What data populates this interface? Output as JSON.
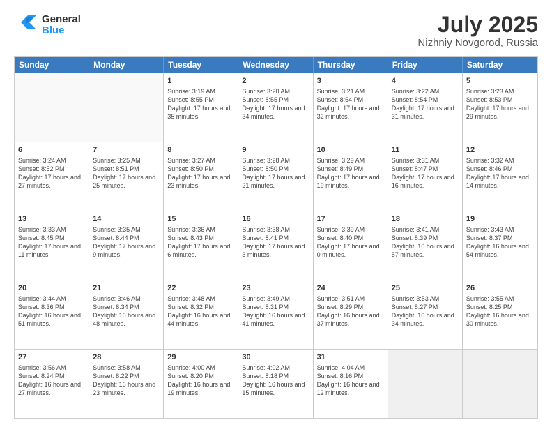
{
  "logo": {
    "general": "General",
    "blue": "Blue"
  },
  "title": {
    "month": "July 2025",
    "location": "Nizhniy Novgorod, Russia"
  },
  "header_days": [
    "Sunday",
    "Monday",
    "Tuesday",
    "Wednesday",
    "Thursday",
    "Friday",
    "Saturday"
  ],
  "rows": [
    [
      {
        "day": "",
        "text": "",
        "empty": true
      },
      {
        "day": "",
        "text": "",
        "empty": true
      },
      {
        "day": "1",
        "text": "Sunrise: 3:19 AM\nSunset: 8:55 PM\nDaylight: 17 hours and 35 minutes."
      },
      {
        "day": "2",
        "text": "Sunrise: 3:20 AM\nSunset: 8:55 PM\nDaylight: 17 hours and 34 minutes."
      },
      {
        "day": "3",
        "text": "Sunrise: 3:21 AM\nSunset: 8:54 PM\nDaylight: 17 hours and 32 minutes."
      },
      {
        "day": "4",
        "text": "Sunrise: 3:22 AM\nSunset: 8:54 PM\nDaylight: 17 hours and 31 minutes."
      },
      {
        "day": "5",
        "text": "Sunrise: 3:23 AM\nSunset: 8:53 PM\nDaylight: 17 hours and 29 minutes."
      }
    ],
    [
      {
        "day": "6",
        "text": "Sunrise: 3:24 AM\nSunset: 8:52 PM\nDaylight: 17 hours and 27 minutes."
      },
      {
        "day": "7",
        "text": "Sunrise: 3:25 AM\nSunset: 8:51 PM\nDaylight: 17 hours and 25 minutes."
      },
      {
        "day": "8",
        "text": "Sunrise: 3:27 AM\nSunset: 8:50 PM\nDaylight: 17 hours and 23 minutes."
      },
      {
        "day": "9",
        "text": "Sunrise: 3:28 AM\nSunset: 8:50 PM\nDaylight: 17 hours and 21 minutes."
      },
      {
        "day": "10",
        "text": "Sunrise: 3:29 AM\nSunset: 8:49 PM\nDaylight: 17 hours and 19 minutes."
      },
      {
        "day": "11",
        "text": "Sunrise: 3:31 AM\nSunset: 8:47 PM\nDaylight: 17 hours and 16 minutes."
      },
      {
        "day": "12",
        "text": "Sunrise: 3:32 AM\nSunset: 8:46 PM\nDaylight: 17 hours and 14 minutes."
      }
    ],
    [
      {
        "day": "13",
        "text": "Sunrise: 3:33 AM\nSunset: 8:45 PM\nDaylight: 17 hours and 11 minutes."
      },
      {
        "day": "14",
        "text": "Sunrise: 3:35 AM\nSunset: 8:44 PM\nDaylight: 17 hours and 9 minutes."
      },
      {
        "day": "15",
        "text": "Sunrise: 3:36 AM\nSunset: 8:43 PM\nDaylight: 17 hours and 6 minutes."
      },
      {
        "day": "16",
        "text": "Sunrise: 3:38 AM\nSunset: 8:41 PM\nDaylight: 17 hours and 3 minutes."
      },
      {
        "day": "17",
        "text": "Sunrise: 3:39 AM\nSunset: 8:40 PM\nDaylight: 17 hours and 0 minutes."
      },
      {
        "day": "18",
        "text": "Sunrise: 3:41 AM\nSunset: 8:39 PM\nDaylight: 16 hours and 57 minutes."
      },
      {
        "day": "19",
        "text": "Sunrise: 3:43 AM\nSunset: 8:37 PM\nDaylight: 16 hours and 54 minutes."
      }
    ],
    [
      {
        "day": "20",
        "text": "Sunrise: 3:44 AM\nSunset: 8:36 PM\nDaylight: 16 hours and 51 minutes."
      },
      {
        "day": "21",
        "text": "Sunrise: 3:46 AM\nSunset: 8:34 PM\nDaylight: 16 hours and 48 minutes."
      },
      {
        "day": "22",
        "text": "Sunrise: 3:48 AM\nSunset: 8:32 PM\nDaylight: 16 hours and 44 minutes."
      },
      {
        "day": "23",
        "text": "Sunrise: 3:49 AM\nSunset: 8:31 PM\nDaylight: 16 hours and 41 minutes."
      },
      {
        "day": "24",
        "text": "Sunrise: 3:51 AM\nSunset: 8:29 PM\nDaylight: 16 hours and 37 minutes."
      },
      {
        "day": "25",
        "text": "Sunrise: 3:53 AM\nSunset: 8:27 PM\nDaylight: 16 hours and 34 minutes."
      },
      {
        "day": "26",
        "text": "Sunrise: 3:55 AM\nSunset: 8:25 PM\nDaylight: 16 hours and 30 minutes."
      }
    ],
    [
      {
        "day": "27",
        "text": "Sunrise: 3:56 AM\nSunset: 8:24 PM\nDaylight: 16 hours and 27 minutes."
      },
      {
        "day": "28",
        "text": "Sunrise: 3:58 AM\nSunset: 8:22 PM\nDaylight: 16 hours and 23 minutes."
      },
      {
        "day": "29",
        "text": "Sunrise: 4:00 AM\nSunset: 8:20 PM\nDaylight: 16 hours and 19 minutes."
      },
      {
        "day": "30",
        "text": "Sunrise: 4:02 AM\nSunset: 8:18 PM\nDaylight: 16 hours and 15 minutes."
      },
      {
        "day": "31",
        "text": "Sunrise: 4:04 AM\nSunset: 8:16 PM\nDaylight: 16 hours and 12 minutes."
      },
      {
        "day": "",
        "text": "",
        "empty": true,
        "shaded": true
      },
      {
        "day": "",
        "text": "",
        "empty": true,
        "shaded": true
      }
    ]
  ]
}
